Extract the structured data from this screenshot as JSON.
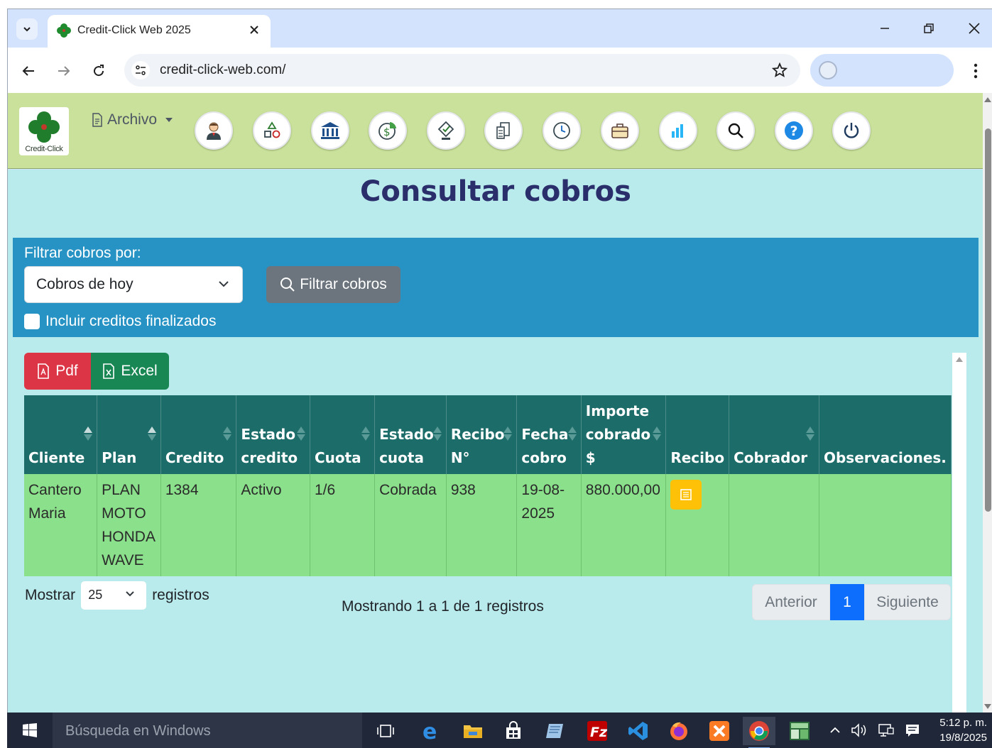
{
  "browser": {
    "tab_title": "Credit-Click Web 2025",
    "url": "credit-click-web.com/"
  },
  "app": {
    "logo_caption": "Credit-Click",
    "menu_archivo": "Archivo",
    "toolbar_icons": [
      "user-icon",
      "shapes-icon",
      "bank-icon",
      "money-icon",
      "approve-icon",
      "calculator-icon",
      "clock-icon",
      "briefcase-icon",
      "bar-chart-icon",
      "search-icon",
      "help-icon",
      "power-icon"
    ]
  },
  "page": {
    "title": "Consultar cobros"
  },
  "filter": {
    "label": "Filtrar cobros por:",
    "selected": "Cobros de hoy",
    "button": "Filtrar cobros",
    "checkbox_label": "Incluir creditos finalizados"
  },
  "export": {
    "pdf": "Pdf",
    "excel": "Excel"
  },
  "table": {
    "columns": [
      [
        "Cliente"
      ],
      [
        "Plan"
      ],
      [
        "Credito"
      ],
      [
        "Estado",
        "credito"
      ],
      [
        "Cuota"
      ],
      [
        "Estado",
        "cuota"
      ],
      [
        "Recibo",
        "N°"
      ],
      [
        "Fecha",
        "cobro"
      ],
      [
        "Importe",
        "cobrado",
        "$"
      ],
      [
        "Recibo"
      ],
      [
        "Cobrador"
      ],
      [
        "Observaciones."
      ]
    ],
    "rows": [
      {
        "cliente": [
          "Cantero",
          "Maria"
        ],
        "plan": [
          "PLAN",
          "MOTO",
          "HONDA",
          "WAVE"
        ],
        "credito": "1384",
        "estado_credito": "Activo",
        "cuota": "1/6",
        "estado_cuota": "Cobrada",
        "recibo_n": "938",
        "fecha_cobro": [
          "19-08-",
          "2025"
        ],
        "importe": "880.000,00",
        "cobrador": "",
        "observaciones": ""
      }
    ]
  },
  "footer": {
    "show_label": "Mostrar",
    "page_length": "25",
    "records_label": "registros",
    "info": "Mostrando 1 a 1 de 1 registros",
    "prev": "Anterior",
    "current_page": "1",
    "next": "Siguiente"
  },
  "taskbar": {
    "search_placeholder": "Búsqueda en Windows",
    "time": "5:12 p. m.",
    "date": "19/8/2025"
  },
  "colors": {
    "header_bg": "#c9e19a",
    "content_bg": "#b9eaec",
    "filter_bg": "#2793c4",
    "table_head": "#1c6c69",
    "table_row": "#8be08b",
    "title": "#2a2f6b"
  }
}
